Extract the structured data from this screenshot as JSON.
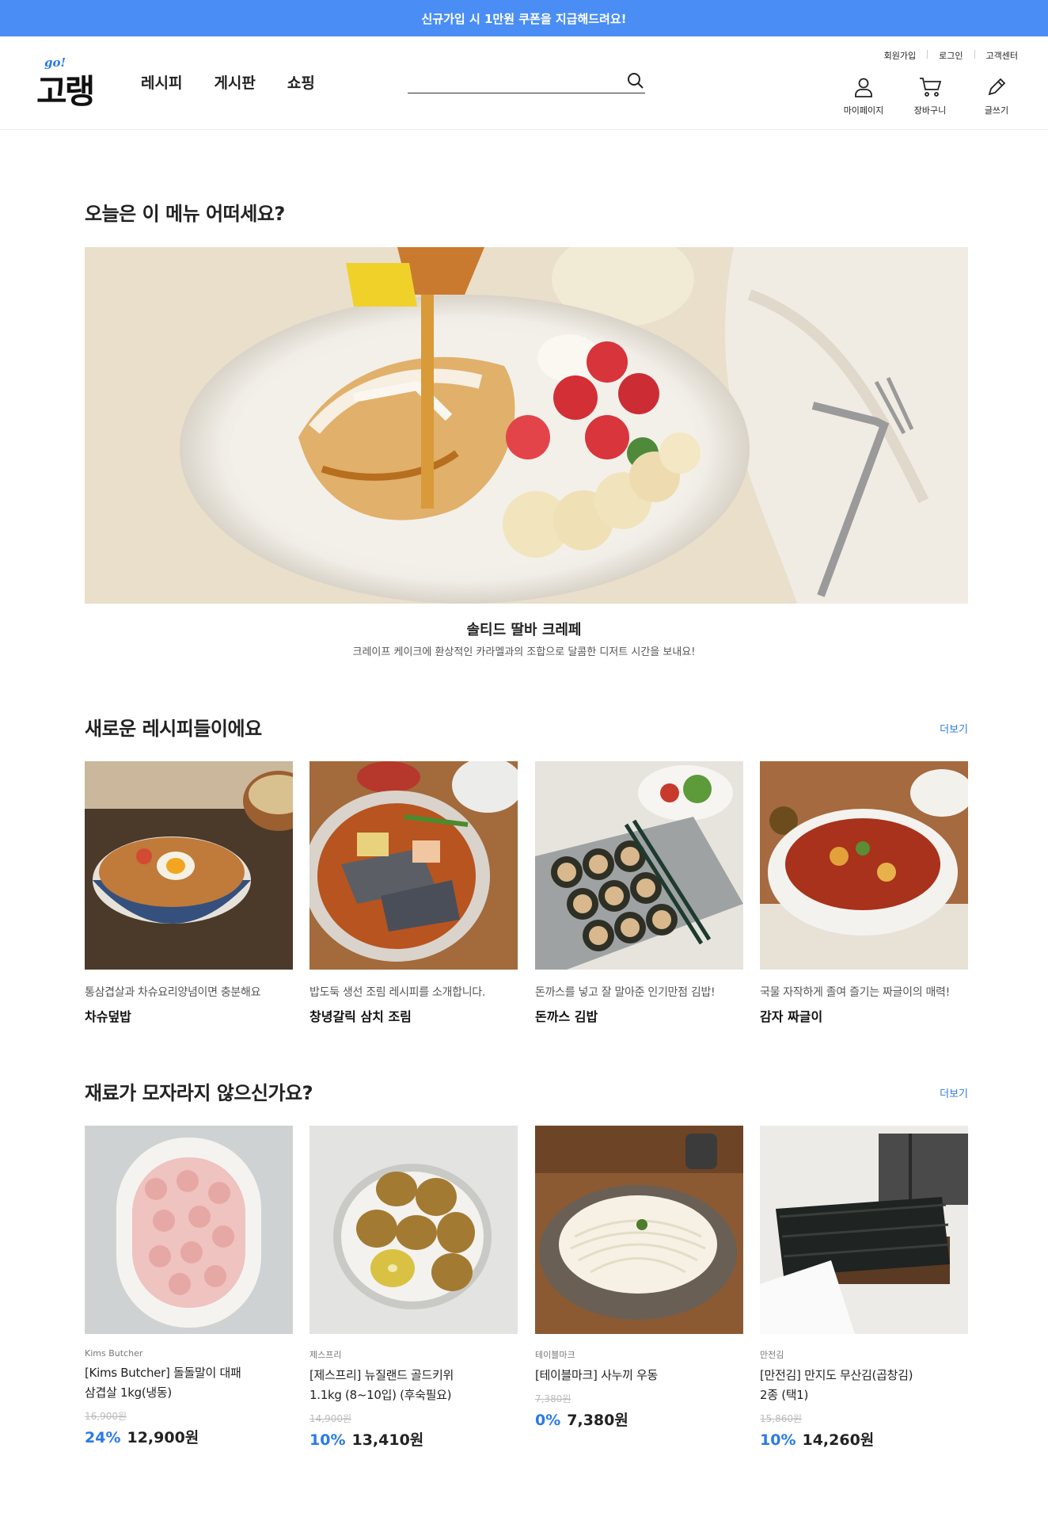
{
  "banner": {
    "text": "신규가입 시 1만원 쿠폰을 지급해드려요!"
  },
  "header": {
    "logo_go": "go!",
    "logo_text": "고랭",
    "nav": [
      "레시피",
      "게시판",
      "쇼핑"
    ],
    "search_placeholder": "",
    "util_links": [
      "회원가입",
      "로그인",
      "고객센터"
    ],
    "icon_buttons": [
      {
        "label": "마이페이지",
        "icon": "user-icon"
      },
      {
        "label": "장바구니",
        "icon": "cart-icon"
      },
      {
        "label": "글쓰기",
        "icon": "pencil-icon"
      }
    ]
  },
  "today": {
    "title": "오늘은 이 메뉴 어떠세요?",
    "dish_name": "솔티드 딸바 크레페",
    "dish_desc": "크레이프 케이크에 환상적인 카라멜과의 조합으로 달콤한 디저트 시간을 보내요!"
  },
  "new_recipes": {
    "title": "새로운 레시피들이에요",
    "more": "더보기",
    "items": [
      {
        "desc": "통삼겹살과 차슈요리양념이면 충분해요",
        "name": "차슈덮밥"
      },
      {
        "desc": "밥도둑 생선 조림 레시피를 소개합니다.",
        "name": "창녕갈릭 삼치 조림"
      },
      {
        "desc": "돈까스를 넣고 잘 말아준 인기만점 김밥!",
        "name": "돈까스 김밥"
      },
      {
        "desc": "국물 자작하게 졸여 즐기는 짜글이의 매력!",
        "name": "감자 짜글이"
      }
    ]
  },
  "ingredients": {
    "title": "재료가 모자라지 않으신가요?",
    "more": "더보기",
    "items": [
      {
        "brand": "Kims Butcher",
        "name_line1": "[Kims Butcher] 돌돌말이 대패",
        "name_line2": "삼겹살 1kg(냉동)",
        "original_price": "16,900원",
        "discount": "24%",
        "price": "12,900원"
      },
      {
        "brand": "제스프리",
        "name_line1": "[제스프리] 뉴질랜드 골드키위",
        "name_line2": "1.1kg (8~10입) (후숙필요)",
        "original_price": "14,900원",
        "discount": "10%",
        "price": "13,410원"
      },
      {
        "brand": "테이블마크",
        "name_line1": "[테이블마크] 사누끼 우동",
        "name_line2": "",
        "original_price": "7,380원",
        "discount": "0%",
        "price": "7,380원"
      },
      {
        "brand": "만전김",
        "name_line1": "[만전김] 만지도 무산김(곱창김)",
        "name_line2": "2종 (택1)",
        "original_price": "15,860원",
        "discount": "10%",
        "price": "14,260원"
      }
    ]
  },
  "colors": {
    "accent": "#2a7ae8",
    "banner": "#4a8ef5"
  }
}
